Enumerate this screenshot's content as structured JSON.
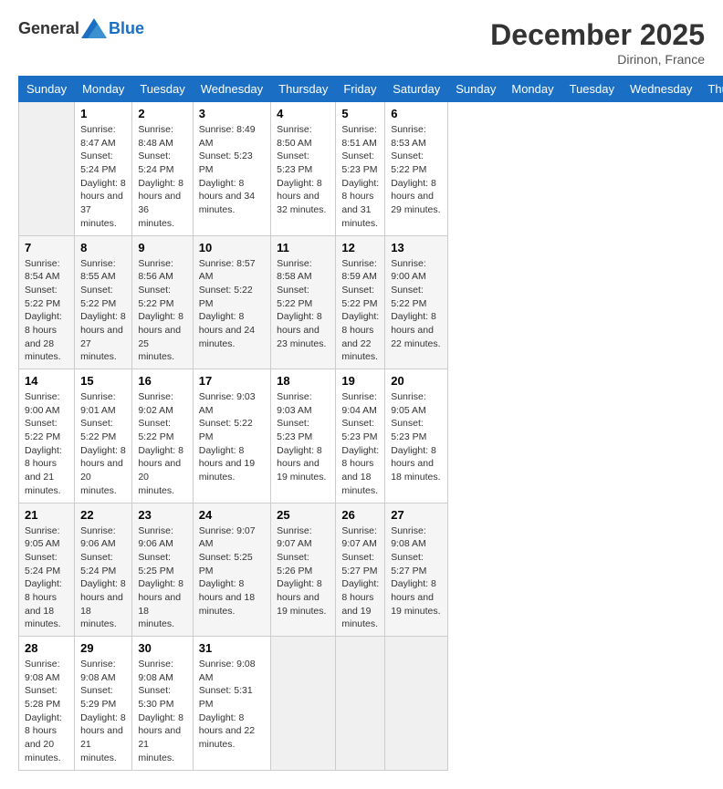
{
  "header": {
    "logo_general": "General",
    "logo_blue": "Blue",
    "month_year": "December 2025",
    "location": "Dirinon, France"
  },
  "calendar": {
    "days_of_week": [
      "Sunday",
      "Monday",
      "Tuesday",
      "Wednesday",
      "Thursday",
      "Friday",
      "Saturday"
    ],
    "weeks": [
      [
        {
          "day": "",
          "empty": true
        },
        {
          "day": "1",
          "sunrise": "8:47 AM",
          "sunset": "5:24 PM",
          "daylight": "8 hours and 37 minutes."
        },
        {
          "day": "2",
          "sunrise": "8:48 AM",
          "sunset": "5:24 PM",
          "daylight": "8 hours and 36 minutes."
        },
        {
          "day": "3",
          "sunrise": "8:49 AM",
          "sunset": "5:23 PM",
          "daylight": "8 hours and 34 minutes."
        },
        {
          "day": "4",
          "sunrise": "8:50 AM",
          "sunset": "5:23 PM",
          "daylight": "8 hours and 32 minutes."
        },
        {
          "day": "5",
          "sunrise": "8:51 AM",
          "sunset": "5:23 PM",
          "daylight": "8 hours and 31 minutes."
        },
        {
          "day": "6",
          "sunrise": "8:53 AM",
          "sunset": "5:22 PM",
          "daylight": "8 hours and 29 minutes."
        }
      ],
      [
        {
          "day": "7",
          "sunrise": "8:54 AM",
          "sunset": "5:22 PM",
          "daylight": "8 hours and 28 minutes."
        },
        {
          "day": "8",
          "sunrise": "8:55 AM",
          "sunset": "5:22 PM",
          "daylight": "8 hours and 27 minutes."
        },
        {
          "day": "9",
          "sunrise": "8:56 AM",
          "sunset": "5:22 PM",
          "daylight": "8 hours and 25 minutes."
        },
        {
          "day": "10",
          "sunrise": "8:57 AM",
          "sunset": "5:22 PM",
          "daylight": "8 hours and 24 minutes."
        },
        {
          "day": "11",
          "sunrise": "8:58 AM",
          "sunset": "5:22 PM",
          "daylight": "8 hours and 23 minutes."
        },
        {
          "day": "12",
          "sunrise": "8:59 AM",
          "sunset": "5:22 PM",
          "daylight": "8 hours and 22 minutes."
        },
        {
          "day": "13",
          "sunrise": "9:00 AM",
          "sunset": "5:22 PM",
          "daylight": "8 hours and 22 minutes."
        }
      ],
      [
        {
          "day": "14",
          "sunrise": "9:00 AM",
          "sunset": "5:22 PM",
          "daylight": "8 hours and 21 minutes."
        },
        {
          "day": "15",
          "sunrise": "9:01 AM",
          "sunset": "5:22 PM",
          "daylight": "8 hours and 20 minutes."
        },
        {
          "day": "16",
          "sunrise": "9:02 AM",
          "sunset": "5:22 PM",
          "daylight": "8 hours and 20 minutes."
        },
        {
          "day": "17",
          "sunrise": "9:03 AM",
          "sunset": "5:22 PM",
          "daylight": "8 hours and 19 minutes."
        },
        {
          "day": "18",
          "sunrise": "9:03 AM",
          "sunset": "5:23 PM",
          "daylight": "8 hours and 19 minutes."
        },
        {
          "day": "19",
          "sunrise": "9:04 AM",
          "sunset": "5:23 PM",
          "daylight": "8 hours and 18 minutes."
        },
        {
          "day": "20",
          "sunrise": "9:05 AM",
          "sunset": "5:23 PM",
          "daylight": "8 hours and 18 minutes."
        }
      ],
      [
        {
          "day": "21",
          "sunrise": "9:05 AM",
          "sunset": "5:24 PM",
          "daylight": "8 hours and 18 minutes."
        },
        {
          "day": "22",
          "sunrise": "9:06 AM",
          "sunset": "5:24 PM",
          "daylight": "8 hours and 18 minutes."
        },
        {
          "day": "23",
          "sunrise": "9:06 AM",
          "sunset": "5:25 PM",
          "daylight": "8 hours and 18 minutes."
        },
        {
          "day": "24",
          "sunrise": "9:07 AM",
          "sunset": "5:25 PM",
          "daylight": "8 hours and 18 minutes."
        },
        {
          "day": "25",
          "sunrise": "9:07 AM",
          "sunset": "5:26 PM",
          "daylight": "8 hours and 19 minutes."
        },
        {
          "day": "26",
          "sunrise": "9:07 AM",
          "sunset": "5:27 PM",
          "daylight": "8 hours and 19 minutes."
        },
        {
          "day": "27",
          "sunrise": "9:08 AM",
          "sunset": "5:27 PM",
          "daylight": "8 hours and 19 minutes."
        }
      ],
      [
        {
          "day": "28",
          "sunrise": "9:08 AM",
          "sunset": "5:28 PM",
          "daylight": "8 hours and 20 minutes."
        },
        {
          "day": "29",
          "sunrise": "9:08 AM",
          "sunset": "5:29 PM",
          "daylight": "8 hours and 21 minutes."
        },
        {
          "day": "30",
          "sunrise": "9:08 AM",
          "sunset": "5:30 PM",
          "daylight": "8 hours and 21 minutes."
        },
        {
          "day": "31",
          "sunrise": "9:08 AM",
          "sunset": "5:31 PM",
          "daylight": "8 hours and 22 minutes."
        },
        {
          "day": "",
          "empty": true
        },
        {
          "day": "",
          "empty": true
        },
        {
          "day": "",
          "empty": true
        }
      ]
    ]
  }
}
